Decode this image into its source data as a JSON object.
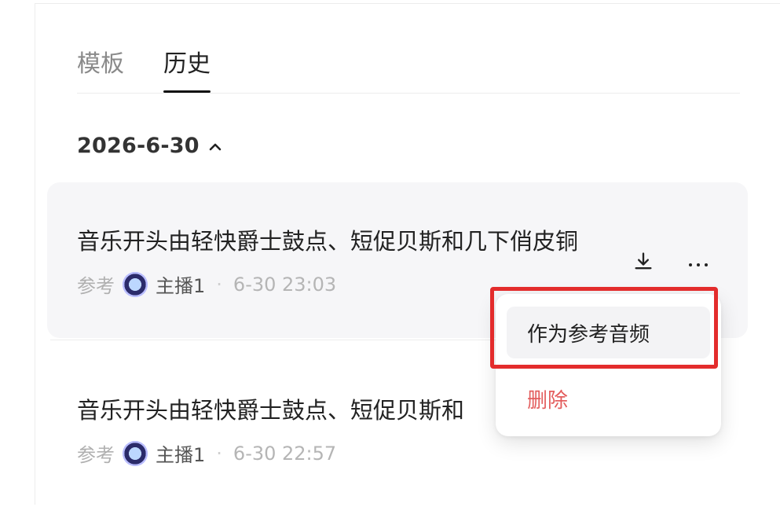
{
  "tabs": [
    {
      "label": "模板",
      "active": false
    },
    {
      "label": "历史",
      "active": true
    }
  ],
  "date_group": {
    "label": "2026-6-30"
  },
  "items": [
    {
      "title": "音乐开头由轻快爵士鼓点、短促贝斯和几下俏皮铜",
      "ref_label": "参考",
      "speaker": "主播1",
      "time": "6-30 23:03",
      "show_actions": true
    },
    {
      "title": "音乐开头由轻快爵士鼓点、短促贝斯和",
      "ref_label": "参考",
      "speaker": "主播1",
      "time": "6-30 22:57",
      "show_actions": false
    }
  ],
  "menu": {
    "items": [
      {
        "label": "作为参考音频"
      },
      {
        "label": "删除",
        "color": "#e35d5d"
      }
    ]
  },
  "colors": {
    "highlight_border": "#e32c2c",
    "hover_bg": "#f6f6f8"
  },
  "icons": {
    "download": "download-icon",
    "more": "more-icon",
    "chevron": "chevron-up-icon"
  }
}
